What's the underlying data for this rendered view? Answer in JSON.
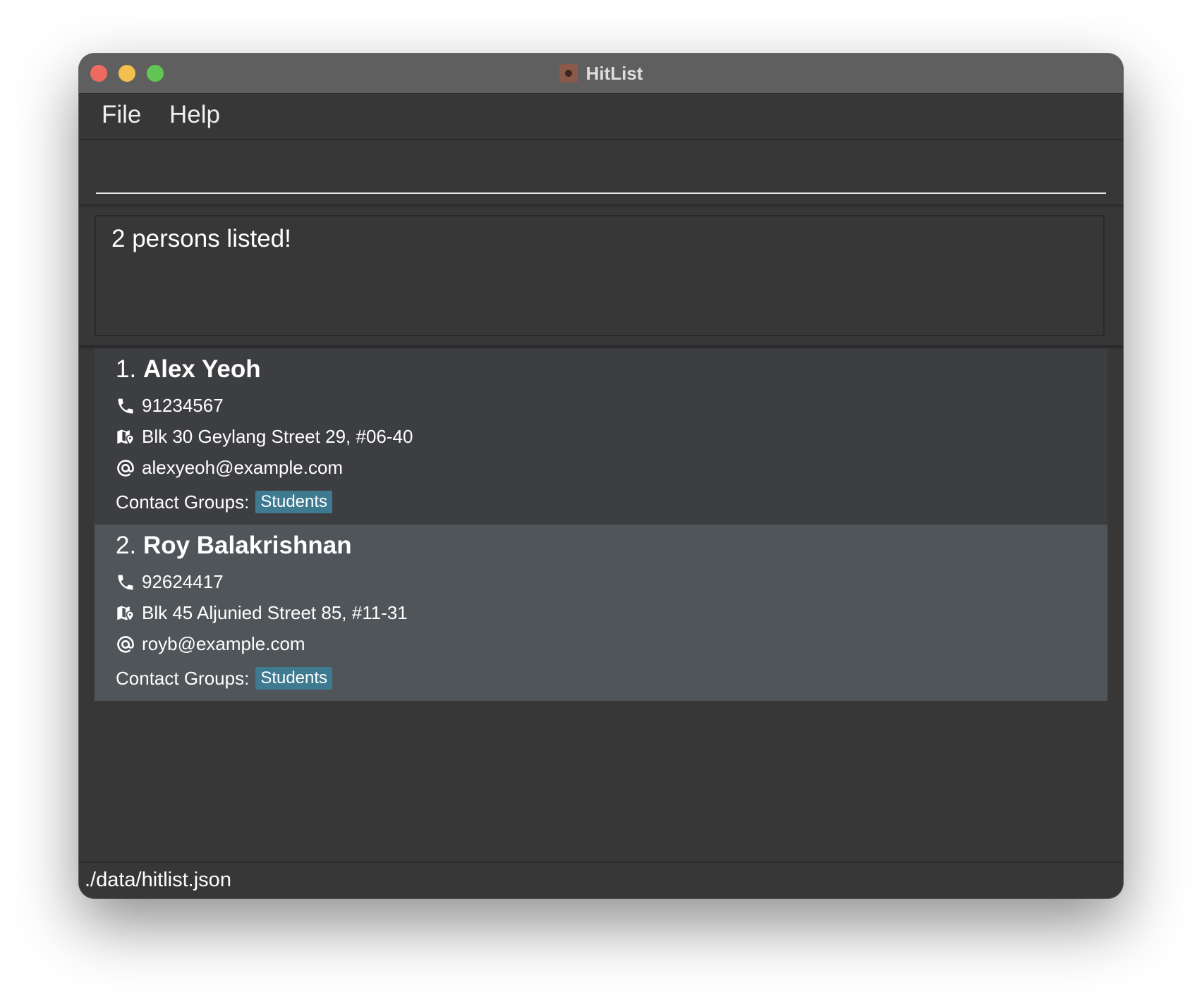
{
  "window": {
    "title": "HitList",
    "app_icon": "hitlist-app-icon"
  },
  "menu": {
    "file": "File",
    "help": "Help"
  },
  "command": {
    "value": ""
  },
  "result": {
    "message": "2 persons listed!"
  },
  "persons": [
    {
      "index": "1.",
      "name": "Alex Yeoh",
      "phone": "91234567",
      "address": "Blk 30 Geylang Street 29, #06-40",
      "email": "alexyeoh@example.com",
      "groups_label": "Contact Groups:",
      "groups": [
        "Students"
      ]
    },
    {
      "index": "2.",
      "name": "Roy Balakrishnan",
      "phone": "92624417",
      "address": "Blk 45 Aljunied Street 85, #11-31",
      "email": "royb@example.com",
      "groups_label": "Contact Groups:",
      "groups": [
        "Students"
      ]
    }
  ],
  "status": {
    "file_path": "./data/hitlist.json"
  },
  "colors": {
    "background": "#373737",
    "card_default": "#3d3e41",
    "card_selected": "#505559",
    "tag": "#3e7b91"
  }
}
